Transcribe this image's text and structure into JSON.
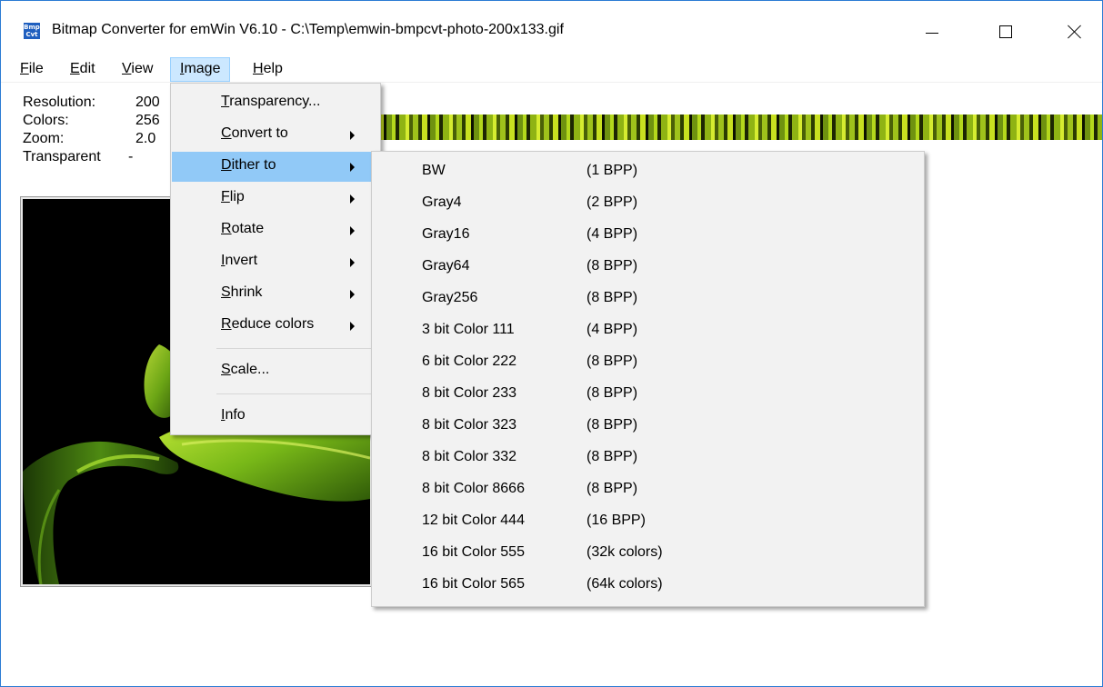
{
  "window": {
    "title": "Bitmap Converter for emWin V6.10 - C:\\Temp\\emwin-bmpcvt-photo-200x133.gif",
    "icon_text_top": "Bmp",
    "icon_text_bottom": "Cvt",
    "icon": "app-icon",
    "controls": [
      "minimize-icon",
      "maximize-icon",
      "close-icon"
    ]
  },
  "menubar": {
    "file": {
      "underline": "F",
      "rest": "ile"
    },
    "edit": {
      "underline": "E",
      "rest": "dit"
    },
    "view": {
      "underline": "V",
      "rest": "iew"
    },
    "image": {
      "underline": "I",
      "rest": "mage"
    },
    "help": {
      "underline": "H",
      "rest": "elp"
    }
  },
  "info": {
    "resolution_label": "Resolution:",
    "resolution_value": "200",
    "colors_label": "Colors:",
    "colors_value": "256",
    "zoom_label": "Zoom:",
    "zoom_value": "2.0",
    "transparent_label": "Transparent",
    "transparent_value": "-"
  },
  "image_menu": {
    "items": [
      {
        "underline": "T",
        "rest": "ransparency...",
        "submenu": false
      },
      {
        "underline": "C",
        "rest": "onvert to",
        "submenu": true
      },
      {
        "underline": "D",
        "rest": "ither to",
        "submenu": true,
        "active": true
      },
      {
        "underline": "F",
        "rest": "lip",
        "submenu": true
      },
      {
        "underline": "R",
        "rest": "otate",
        "submenu": true
      },
      {
        "underline": "I",
        "rest": "nvert",
        "submenu": true
      },
      {
        "underline": "S",
        "rest": "hrink",
        "submenu": true
      },
      {
        "underline": "R",
        "rest": "educe colors",
        "submenu": true
      },
      {
        "underline": "S",
        "rest": "cale...",
        "submenu": false
      },
      {
        "underline": "I",
        "rest": "nfo",
        "submenu": false
      }
    ]
  },
  "dither_menu": {
    "items": [
      {
        "name": "BW",
        "bpp": "(1 BPP)"
      },
      {
        "name": "Gray4",
        "bpp": "(2 BPP)"
      },
      {
        "name": "Gray16",
        "bpp": "(4 BPP)"
      },
      {
        "name": "Gray64",
        "bpp": "(8 BPP)"
      },
      {
        "name": "Gray256",
        "bpp": "(8 BPP)"
      },
      {
        "name": "3 bit Color 111",
        "bpp": "(4 BPP)"
      },
      {
        "name": "6 bit Color 222",
        "bpp": "(8 BPP)"
      },
      {
        "name": "8 bit Color 233",
        "bpp": "(8 BPP)"
      },
      {
        "name": "8 bit Color 323",
        "bpp": "(8 BPP)"
      },
      {
        "name": "8 bit Color 332",
        "bpp": "(8 BPP)"
      },
      {
        "name": "8 bit Color 8666",
        "bpp": "(8 BPP)"
      },
      {
        "name": "12 bit Color 444",
        "bpp": "(16 BPP)"
      },
      {
        "name": "16 bit Color 555",
        "bpp": "(32k colors)"
      },
      {
        "name": "16 bit Color 565",
        "bpp": "(64k colors)"
      }
    ]
  },
  "colors": {
    "menu_highlight": "#91c9f7",
    "menubar_highlight": "#cce8ff",
    "menu_background": "#f2f2f2",
    "window_border": "#2b7bd4"
  }
}
